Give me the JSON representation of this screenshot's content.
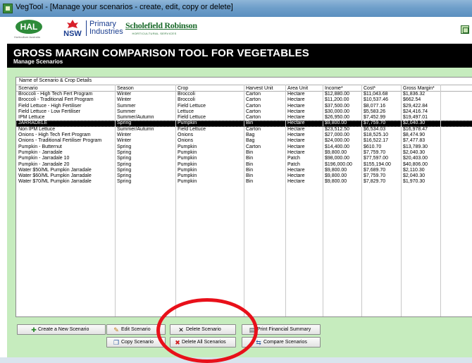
{
  "window": {
    "title": "VegTool - [Manage your scenarios - create, edit, copy or delete]"
  },
  "logos": {
    "hal": "HAL",
    "hal_sub": "Horticulture Australia",
    "nsw": "NSW",
    "primary_industries_line1": "Primary",
    "primary_industries_line2": "Industries",
    "scholefield_name": "Scholefield Robinson",
    "scholefield_sub": "HORTICULTURAL SERVICES"
  },
  "header": {
    "title": "GROSS MARGIN COMPARISON TOOL FOR VEGETABLES",
    "subtitle": "Manage Scenarios"
  },
  "table": {
    "caption": "Name of Scenario & Crop Details",
    "columns": [
      "Scenario",
      "Season",
      "Crop",
      "Harvest Unit",
      "Area Unit",
      "Income*",
      "Cost*",
      "Gross Margin*"
    ],
    "selected_index": 5,
    "rows": [
      [
        "Broccoli - High Tech Fert Program",
        "Winter",
        "Broccoli",
        "Carton",
        "Hectare",
        "$12,880.00",
        "$11,043.68",
        "$1,836.32"
      ],
      [
        "Broccoli - Traditional Fert Program",
        "Winter",
        "Broccoli",
        "Carton",
        "Hectare",
        "$11,200.00",
        "$10,537.46",
        "$662.54"
      ],
      [
        "Field Lettuce - High Fertiliser",
        "Summer",
        "Field Lettuce",
        "Carton",
        "Hectare",
        "$37,500.00",
        "$8,077.16",
        "$29,422.84"
      ],
      [
        "Field Lettuce - Low Fertiliser",
        "Summer",
        "Lettuce",
        "Carton",
        "Hectare",
        "$30,000.00",
        "$5,583.26",
        "$24,416.74"
      ],
      [
        "IPM Lettuce",
        "Summer/Autumn",
        "Field Lettuce",
        "Carton",
        "Hectare",
        "$26,950.00",
        "$7,452.99",
        "$19,497.01"
      ],
      [
        "JARRADELE",
        "Spring",
        "Pumpkin",
        "Bin",
        "Hectare",
        "$9,800.00",
        "$7,759.70",
        "$2,040.30"
      ],
      [
        "Non IPM Lettuce",
        "Summer/Autumn",
        "Field Lettuce",
        "Carton",
        "Hectare",
        "$23,512.50",
        "$6,534.03",
        "$16,978.47"
      ],
      [
        "Onions - High Tech Fert Program",
        "Winter",
        "Onions",
        "Bag",
        "Hectare",
        "$27,000.00",
        "$18,525.10",
        "$8,474.90"
      ],
      [
        "Onions - Traditional Fertiliser Program",
        "Winter",
        "Onions",
        "Bag",
        "Hectare",
        "$24,000.00",
        "$16,522.17",
        "$7,477.83"
      ],
      [
        "Pumpkin - Butternut",
        "Spring",
        "Pumpkin",
        "Carton",
        "Hectare",
        "$14,400.00",
        "$610.70",
        "$13,789.30"
      ],
      [
        "Pumpkin - Jarradale",
        "Spring",
        "Pumpkin",
        "Bin",
        "Hectare",
        "$9,800.00",
        "$7,759.70",
        "$2,040.30"
      ],
      [
        "Pumpkin - Jarradale 10",
        "Spring",
        "Pumpkin",
        "Bin",
        "Patch",
        "$98,000.00",
        "$77,597.00",
        "$20,403.00"
      ],
      [
        "Pumpkin - Jarradale 20",
        "Spring",
        "Pumpkin",
        "Bin",
        "Patch",
        "$196,000.00",
        "$155,194.00",
        "$40,806.00"
      ],
      [
        "Water $50/ML Pumpkin Jarradale",
        "Spring",
        "Pumpkin",
        "Bin",
        "Hectare",
        "$9,800.00",
        "$7,689.70",
        "$2,110.30"
      ],
      [
        "Water $60/ML Pumpkin Jarradale",
        "Spring",
        "Pumpkin",
        "Bin",
        "Hectare",
        "$9,800.00",
        "$7,759.70",
        "$2,040.30"
      ],
      [
        "Water $70/ML Pumpkin Jarradale",
        "Spring",
        "Pumpkin",
        "Bin",
        "Hectare",
        "$9,800.00",
        "$7,829.70",
        "$1,970.30"
      ]
    ]
  },
  "buttons": {
    "create": "Create a New Scenario",
    "edit": "Edit Scenario",
    "copy": "Copy Scenario",
    "delete": "Delete  Scenario",
    "delete_all": "Delete All Scenarios",
    "print": "Print Financial Summary",
    "compare": "Compare Scenarios"
  },
  "colors": {
    "panel": "#c6ecbe",
    "header": "#000000",
    "annotation_circle": "#e8101a"
  }
}
